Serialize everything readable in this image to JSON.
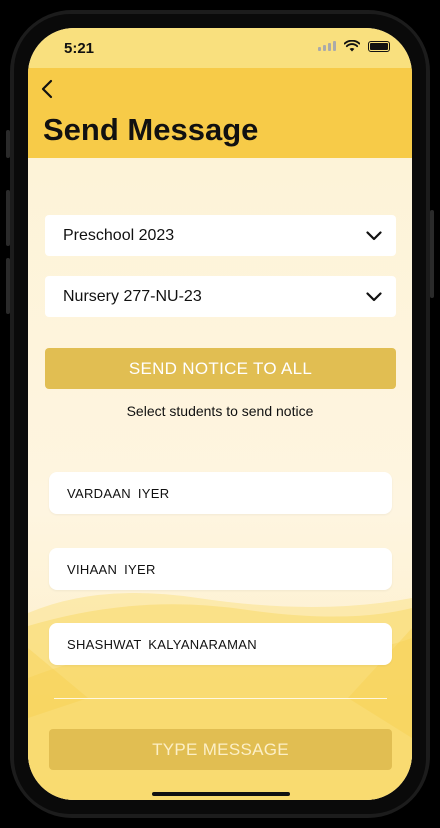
{
  "status": {
    "time": "5:21"
  },
  "header": {
    "title": "Send Message"
  },
  "selectors": {
    "program": "Preschool 2023",
    "class": "Nursery 277-NU-23"
  },
  "send_all_label": "SEND NOTICE TO ALL",
  "hint": "Select students to send notice",
  "students": [
    "VARDAAN  IYER",
    "VIHAAN  IYER",
    "SHASHWAT  KALYANARAMAN"
  ],
  "type_message_label": "TYPE MESSAGE",
  "colors": {
    "header": "#F7CB48",
    "statusbar": "#F9E07E",
    "button": "#E1BE52",
    "background": "#FDF3D8"
  },
  "icons": [
    "back-chevron-icon",
    "chevron-down-icon",
    "signal-icon",
    "wifi-icon",
    "battery-icon"
  ]
}
